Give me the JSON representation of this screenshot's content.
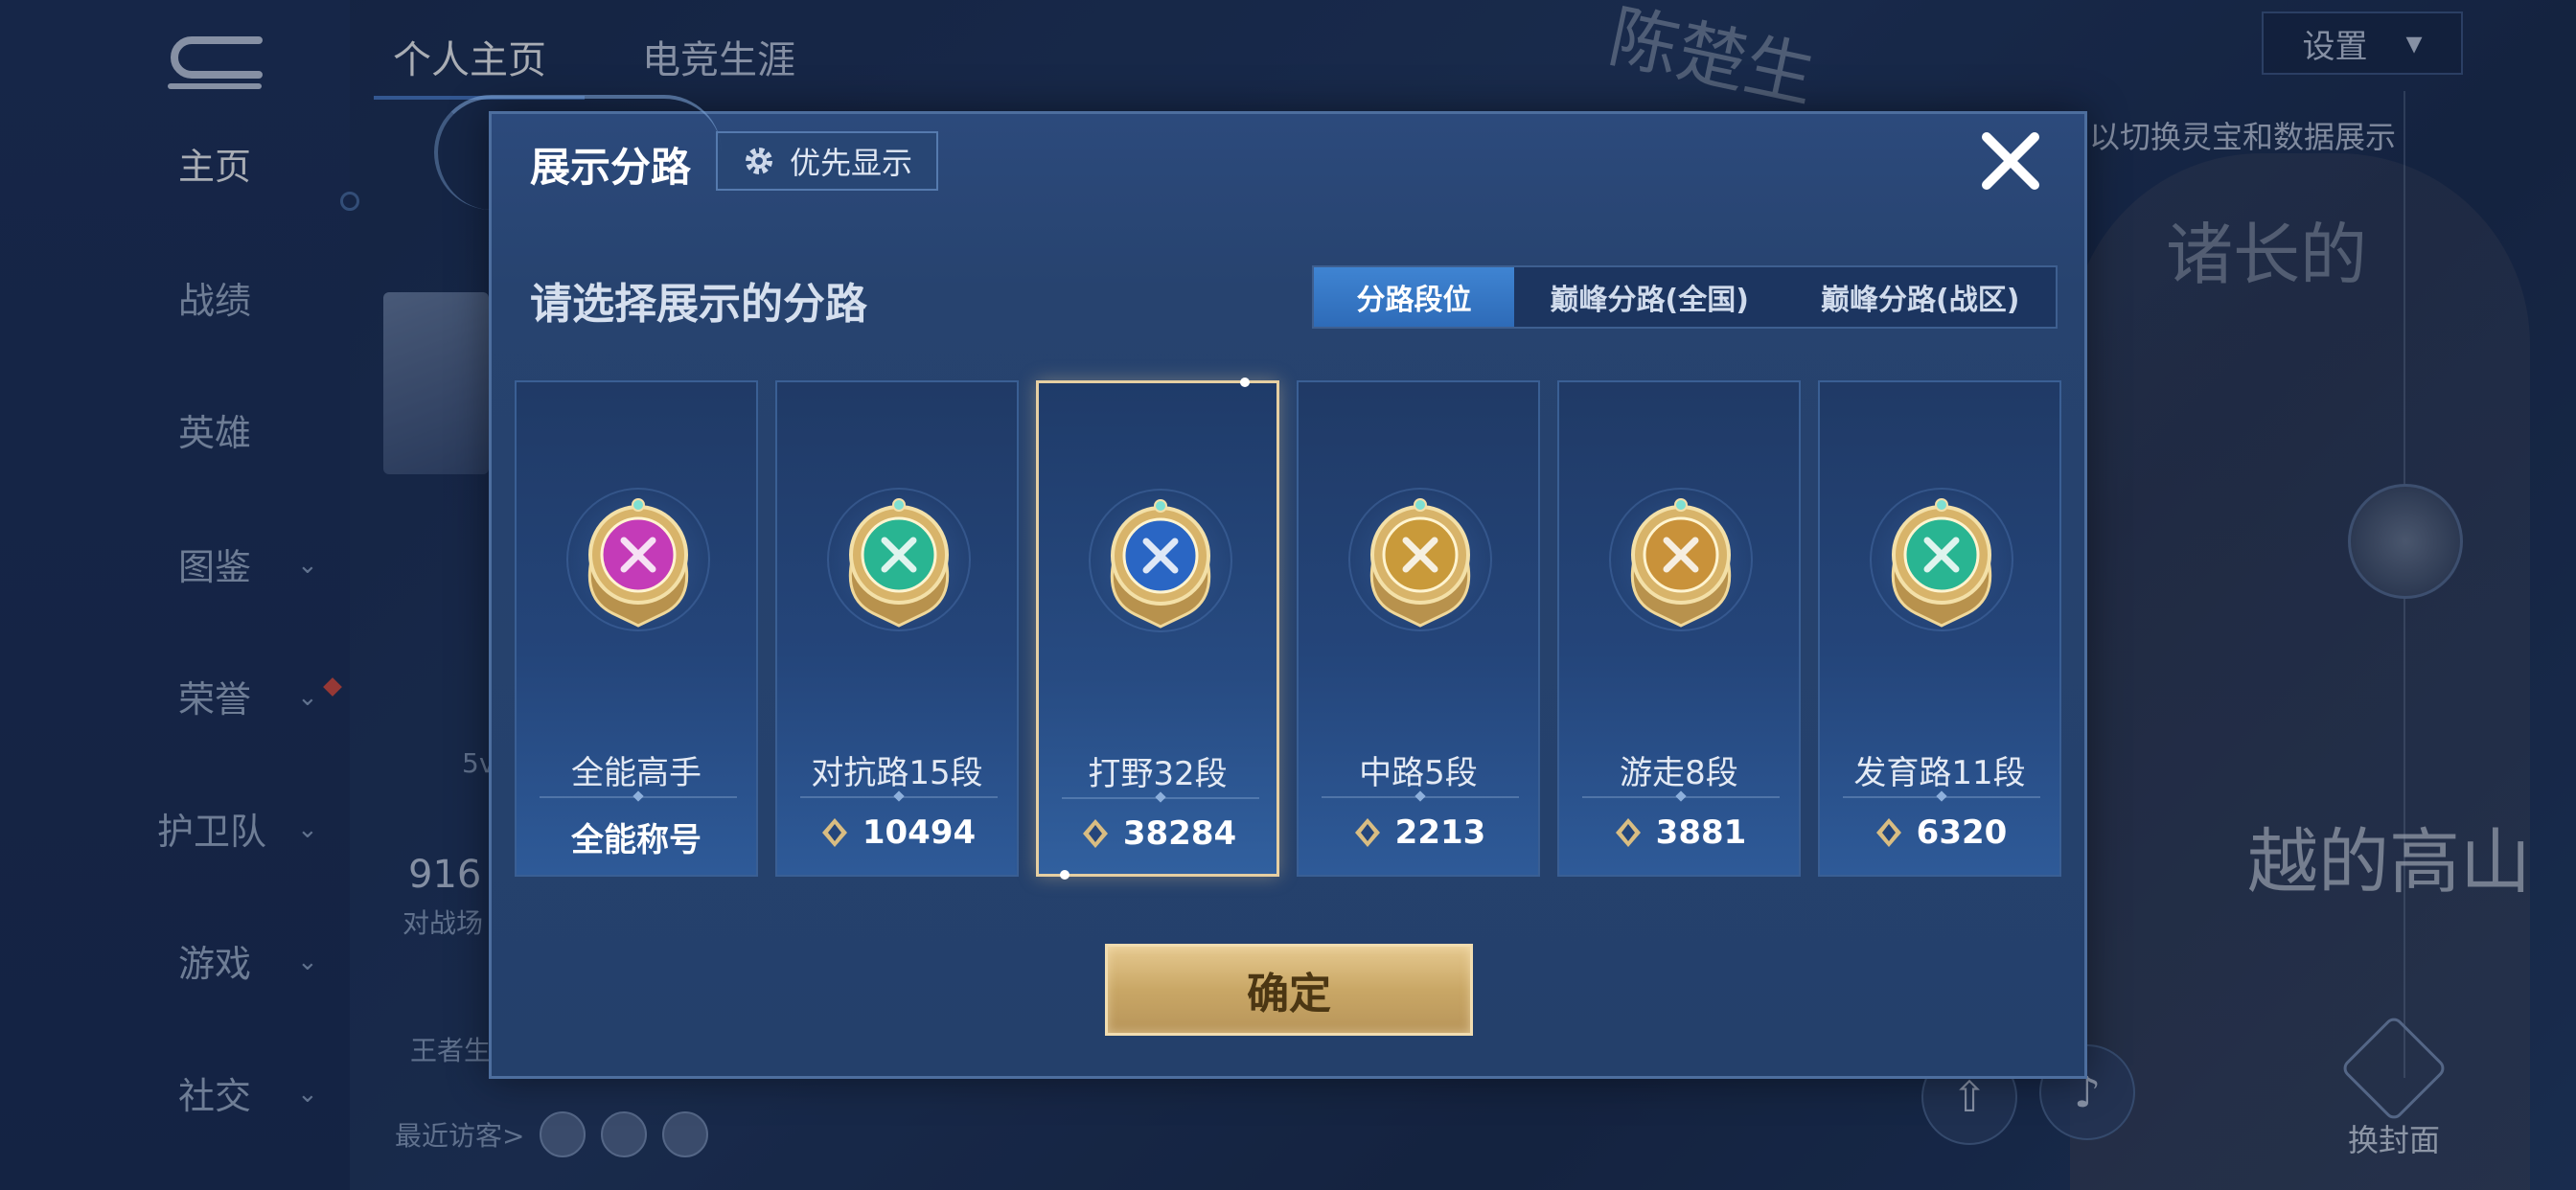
{
  "background": {
    "nav": [
      {
        "label": "主页",
        "active": true
      },
      {
        "label": "战绩"
      },
      {
        "label": "英雄"
      },
      {
        "label": "图鉴",
        "chevron": true
      },
      {
        "label": "荣誉",
        "chevron": true
      },
      {
        "label": "护卫队",
        "chevron": true
      },
      {
        "label": "游戏",
        "chevron": true
      },
      {
        "label": "社交",
        "chevron": true
      }
    ],
    "top_tabs": [
      "个人主页",
      "电竞生涯"
    ],
    "settings_label": "设置",
    "hint_text": "以切换灵宝和数据展示",
    "calligraphy_1": "陈楚生",
    "calligraphy_2": "诸长的",
    "calligraphy_3": "越的高山",
    "stat_number": "916",
    "stat_label": "对战场",
    "small_5v": "5v",
    "wangzhe_label": "王者生",
    "visitors_label": "最近访客>",
    "change_cover_label": "换封面"
  },
  "dialog": {
    "title": "展示分路",
    "priority_button": "优先显示",
    "subtitle": "请选择展示的分路",
    "segments": [
      "分路段位",
      "巅峰分路(全国)",
      "巅峰分路(战区)"
    ],
    "active_segment": 0,
    "cards": [
      {
        "name": "全能高手",
        "value": "全能称号",
        "show_icon": false,
        "badge_color": "#c43bb8",
        "badge_icon": "purple-badge-icon"
      },
      {
        "name": "对抗路15段",
        "value": "10494",
        "show_icon": true,
        "badge_color": "#29b592",
        "badge_icon": "teal-badge-icon"
      },
      {
        "name": "打野32段",
        "value": "38284",
        "show_icon": true,
        "badge_color": "#2a66c4",
        "badge_icon": "blue-dragon-badge-icon",
        "selected": true
      },
      {
        "name": "中路5段",
        "value": "2213",
        "show_icon": true,
        "badge_color": "#c99a3a",
        "badge_icon": "gold-badge-icon"
      },
      {
        "name": "游走8段",
        "value": "3881",
        "show_icon": true,
        "badge_color": "#c9923a",
        "badge_icon": "gold-wings-badge-icon"
      },
      {
        "name": "发育路11段",
        "value": "6320",
        "show_icon": true,
        "badge_color": "#29b592",
        "badge_icon": "teal-badge-icon"
      }
    ],
    "confirm_label": "确定"
  },
  "colors": {
    "accent_blue": "#3f84d2",
    "gold": "#e6c98f",
    "selected_border": "#e6cfa2"
  }
}
